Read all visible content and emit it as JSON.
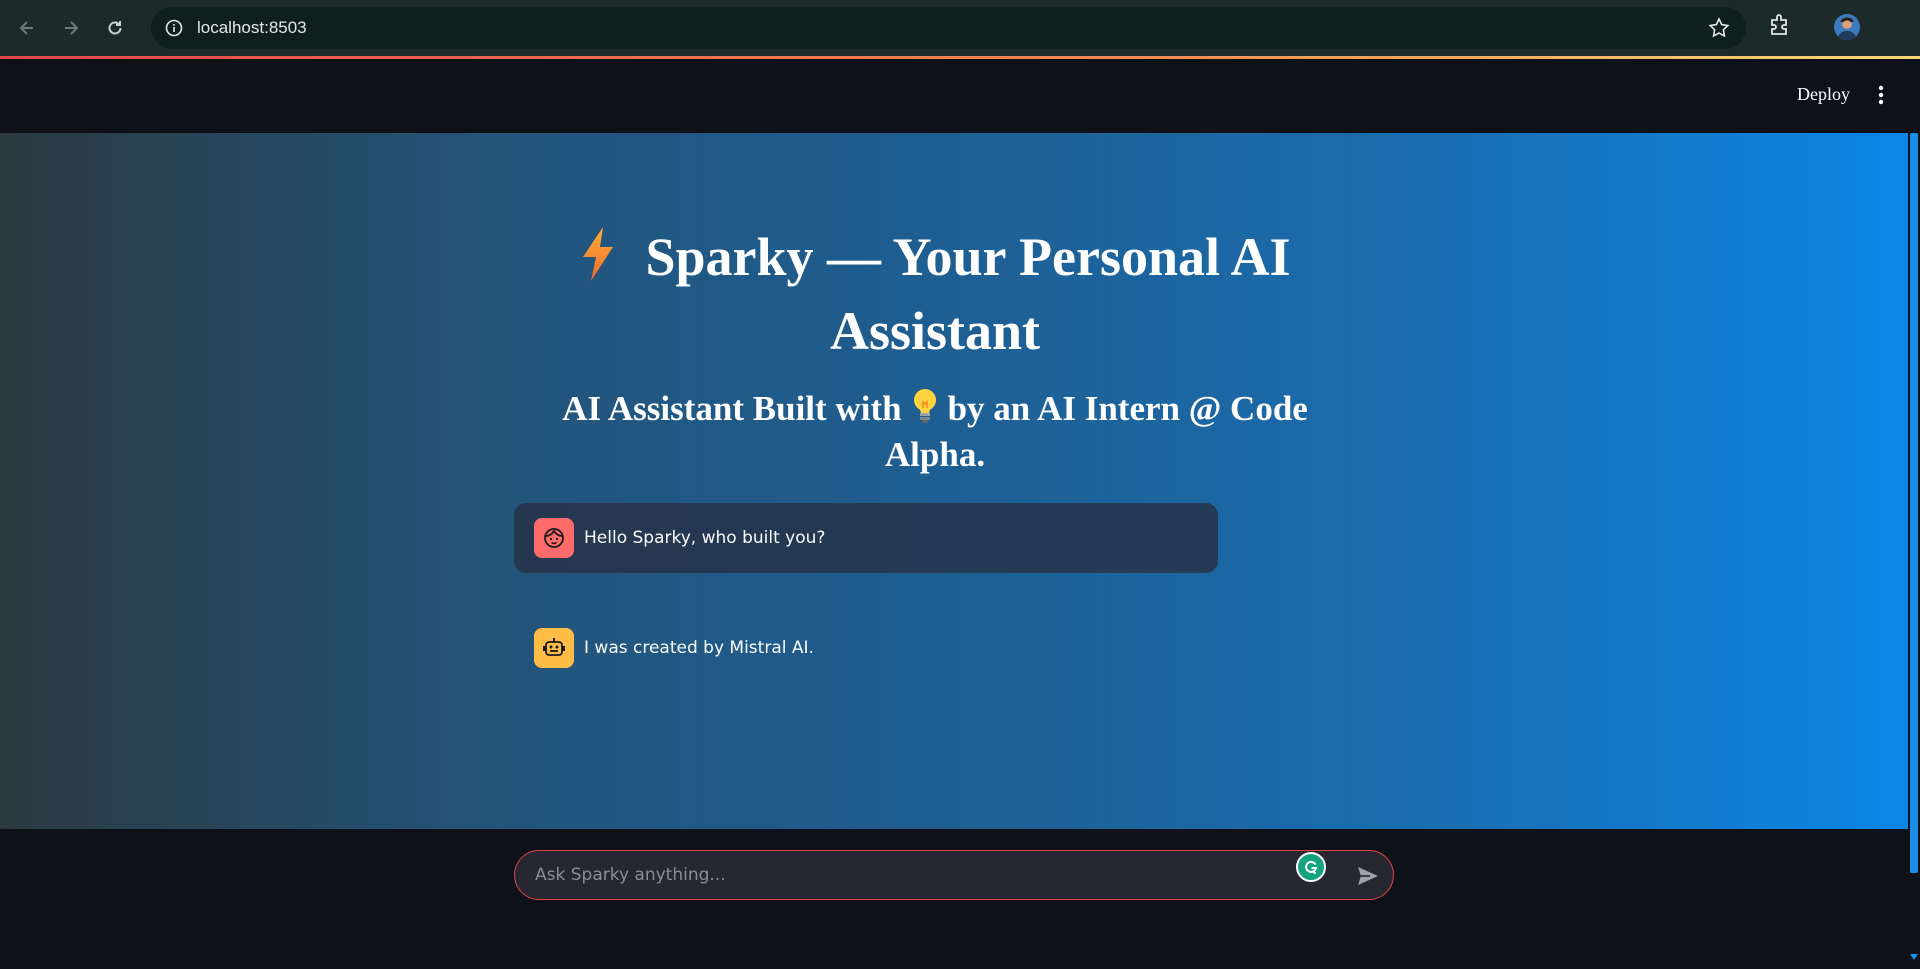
{
  "browser": {
    "url": "localhost:8503"
  },
  "header": {
    "deploy_label": "Deploy"
  },
  "main": {
    "title_line1": "Sparky — Your Personal AI",
    "title_line2": "Assistant",
    "subtitle_part1": "AI Assistant Built with",
    "subtitle_part2": "by an AI Intern @ Code",
    "subtitle_line2": "Alpha."
  },
  "messages": [
    {
      "role": "user",
      "text": "Hello Sparky, who built you?"
    },
    {
      "role": "assistant",
      "text": "I was created by Mistral AI."
    }
  ],
  "input": {
    "placeholder": "Ask Sparky anything..."
  },
  "colors": {
    "accent": "#e0474b",
    "user_avatar": "#ff6b6b",
    "bot_avatar": "#ffbd45",
    "app_bg": "#0e1117"
  }
}
